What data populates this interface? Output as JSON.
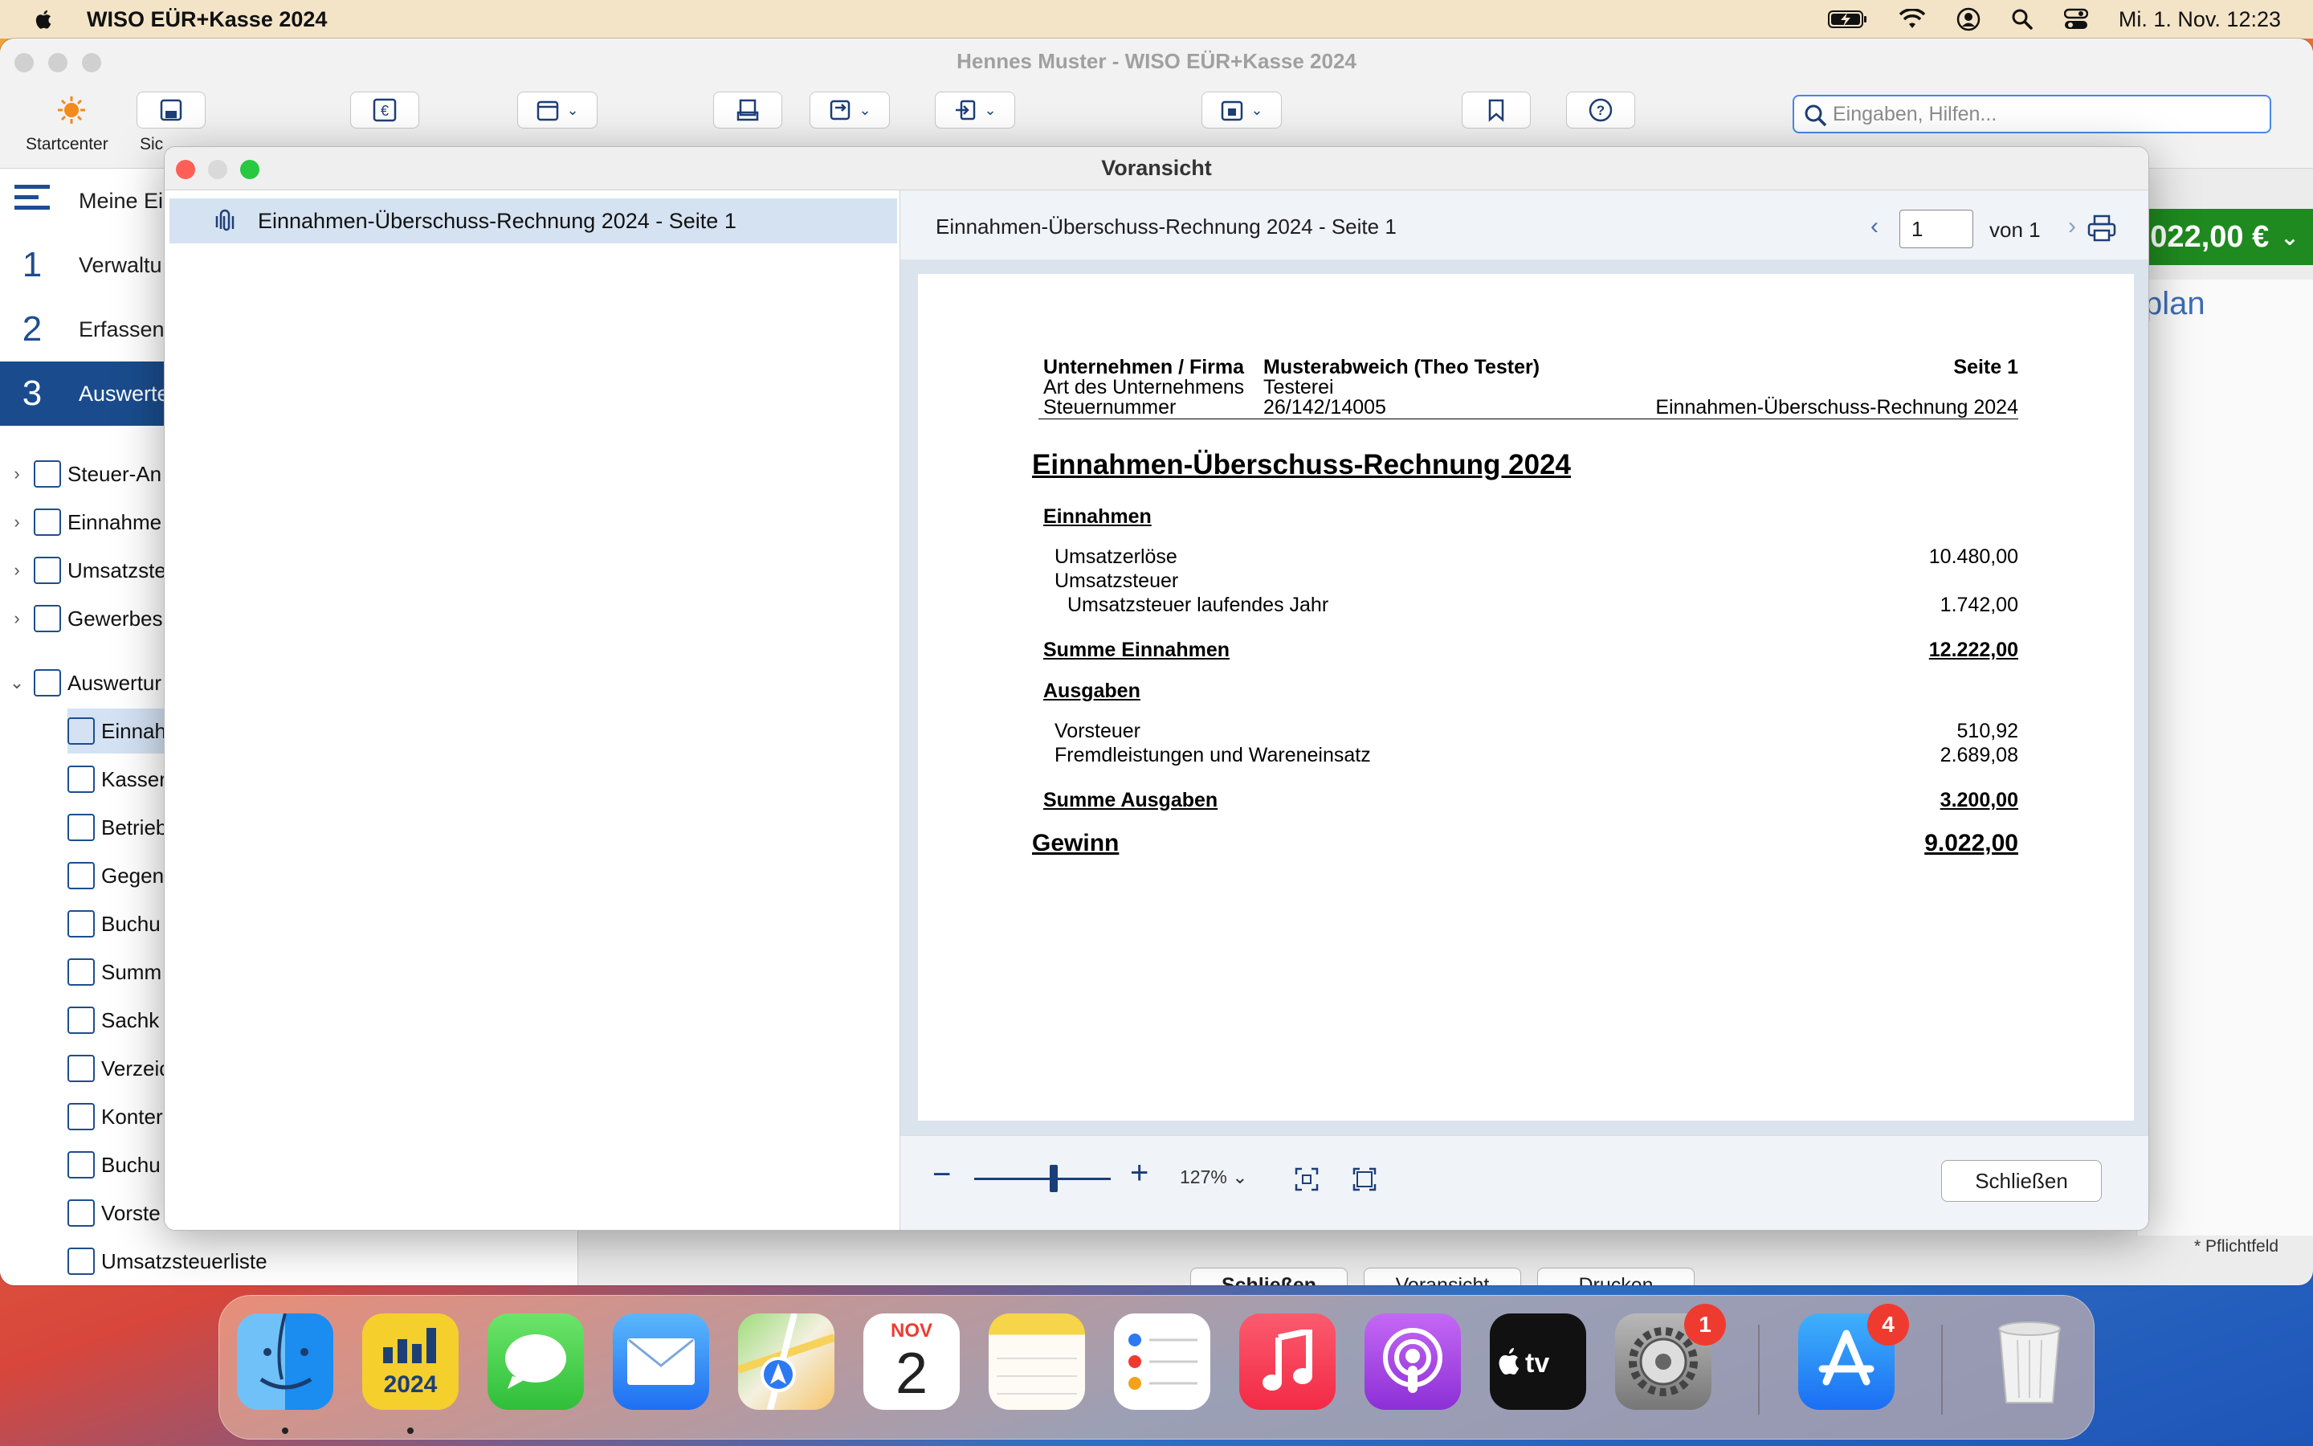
{
  "menubar": {
    "app_name": "WISO EÜR+Kasse 2024",
    "clock": "Mi. 1. Nov.  12:23"
  },
  "main_window": {
    "title": "Hennes Muster - WISO EÜR+Kasse 2024",
    "toolbar": {
      "startcenter_label": "Startcenter",
      "save_label_partial": "Sic",
      "search_placeholder": "Eingaben, Hilfen..."
    },
    "nav": {
      "top_items": [
        {
          "num": "",
          "label": "Meine Ei"
        },
        {
          "num": "1",
          "label": "Verwaltu"
        },
        {
          "num": "2",
          "label": "Erfassen"
        },
        {
          "num": "3",
          "label": "Auswerte"
        }
      ],
      "groups": [
        {
          "label": "Steuer-An"
        },
        {
          "label": "Einnahme"
        },
        {
          "label": "Umsatzste"
        },
        {
          "label": "Gewerbes"
        },
        {
          "label": "Auswertur"
        }
      ],
      "sub_items": [
        {
          "label": "Einnah"
        },
        {
          "label": "Kasser"
        },
        {
          "label": "Betrieb"
        },
        {
          "label": "Gegen"
        },
        {
          "label": "Buchu"
        },
        {
          "label": "Summ"
        },
        {
          "label": "Sachk"
        },
        {
          "label": "Verzeic"
        },
        {
          "label": "Konter"
        },
        {
          "label": "Buchu"
        },
        {
          "label": "Vorste"
        },
        {
          "label": "Umsatzsteuerliste"
        }
      ]
    },
    "total_badge": "022,00 €",
    "plan_label": "plan",
    "pflichtfeld": "* Pflichtfeld",
    "bottom_buttons": {
      "close": "Schließen",
      "preview": "Voransicht",
      "print": "Drucken"
    }
  },
  "preview_dialog": {
    "title": "Voransicht",
    "thumbnail_label": "Einnahmen-Überschuss-Rechnung 2024 - Seite 1",
    "doc_title": "Einnahmen-Überschuss-Rechnung 2024 - Seite 1",
    "page_number": "1",
    "page_of": "von 1",
    "zoom_level": "127%",
    "close_button": "Schließen"
  },
  "document": {
    "header": {
      "company_label": "Unternehmen / Firma",
      "company_value": "Musterabweich (Theo Tester)",
      "type_label": "Art des Unternehmens",
      "type_value": "Testerei",
      "tax_label": "Steuernummer",
      "tax_value": "26/142/14005",
      "page_label": "Seite 1",
      "report_name": "Einnahmen-Überschuss-Rechnung 2024"
    },
    "title": "Einnahmen-Überschuss-Rechnung 2024",
    "income_heading": "Einnahmen",
    "revenue_label": "Umsatzerlöse",
    "revenue_value": "10.480,00",
    "vat_label": "Umsatzsteuer",
    "vat_current_label": "Umsatzsteuer laufendes Jahr",
    "vat_current_value": "1.742,00",
    "income_total_label": "Summe Einnahmen",
    "income_total_value": "12.222,00",
    "expense_heading": "Ausgaben",
    "input_tax_label": "Vorsteuer",
    "input_tax_value": "510,92",
    "third_party_label": "Fremdleistungen und Wareneinsatz",
    "third_party_value": "2.689,08",
    "expense_total_label": "Summe Ausgaben",
    "expense_total_value": "3.200,00",
    "profit_label": "Gewinn",
    "profit_value": "9.022,00"
  },
  "dock": {
    "wiso_year": "2024",
    "calendar_month": "NOV",
    "calendar_day": "2",
    "settings_badge": "1",
    "appstore_badge": "4"
  }
}
